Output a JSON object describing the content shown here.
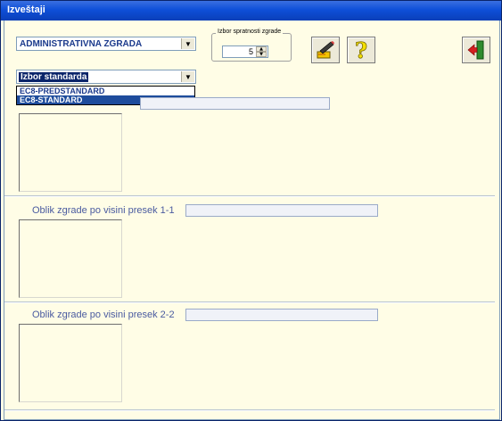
{
  "window": {
    "title": "Izveštaji"
  },
  "building_type": {
    "value": "ADMINISTRATIVNA ZGRADA"
  },
  "floors_group": {
    "legend": "Izbor spratnosti zgrade",
    "value": "5"
  },
  "standard_select": {
    "value": "Izbor standarda",
    "options": [
      "EC8-PREDSTANDARD",
      "EC8-STANDARD"
    ]
  },
  "section1": {
    "label": ""
  },
  "section2": {
    "label": "Oblik zgrade po visini presek 1-1"
  },
  "section3": {
    "label": "Oblik zgrade po visini presek 2-2"
  },
  "icons": {
    "edit": "edit-pencil-icon",
    "help": "question-mark-icon",
    "exit": "exit-door-icon"
  }
}
